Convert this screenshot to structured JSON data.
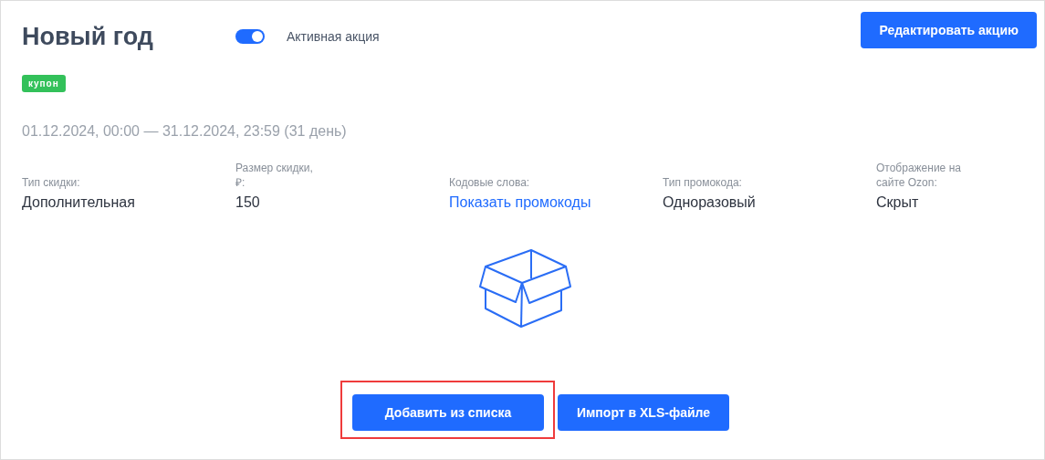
{
  "title": "Новый год",
  "active_toggle": {
    "label": "Активная акция",
    "on": true
  },
  "edit_button": "Редактировать акцию",
  "badge": "купон",
  "period": "01.12.2024, 00:00 — 31.12.2024, 23:59 (31 день)",
  "fields": [
    {
      "label": "Тип скидки:",
      "value": "Дополнительная",
      "kind": "text"
    },
    {
      "label": "Размер скидки, ₽:",
      "value": "150",
      "kind": "text"
    },
    {
      "label": "Кодовые слова:",
      "value": "Показать промокоды",
      "kind": "link"
    },
    {
      "label": "Тип промокода:",
      "value": "Одноразовый",
      "kind": "text"
    },
    {
      "label": "Отображение на сайте Ozon:",
      "value": "Скрыт",
      "kind": "text"
    }
  ],
  "actions": [
    {
      "label": "Добавить из списка",
      "highlighted": true
    },
    {
      "label": "Импорт в XLS-файле",
      "highlighted": false
    }
  ]
}
